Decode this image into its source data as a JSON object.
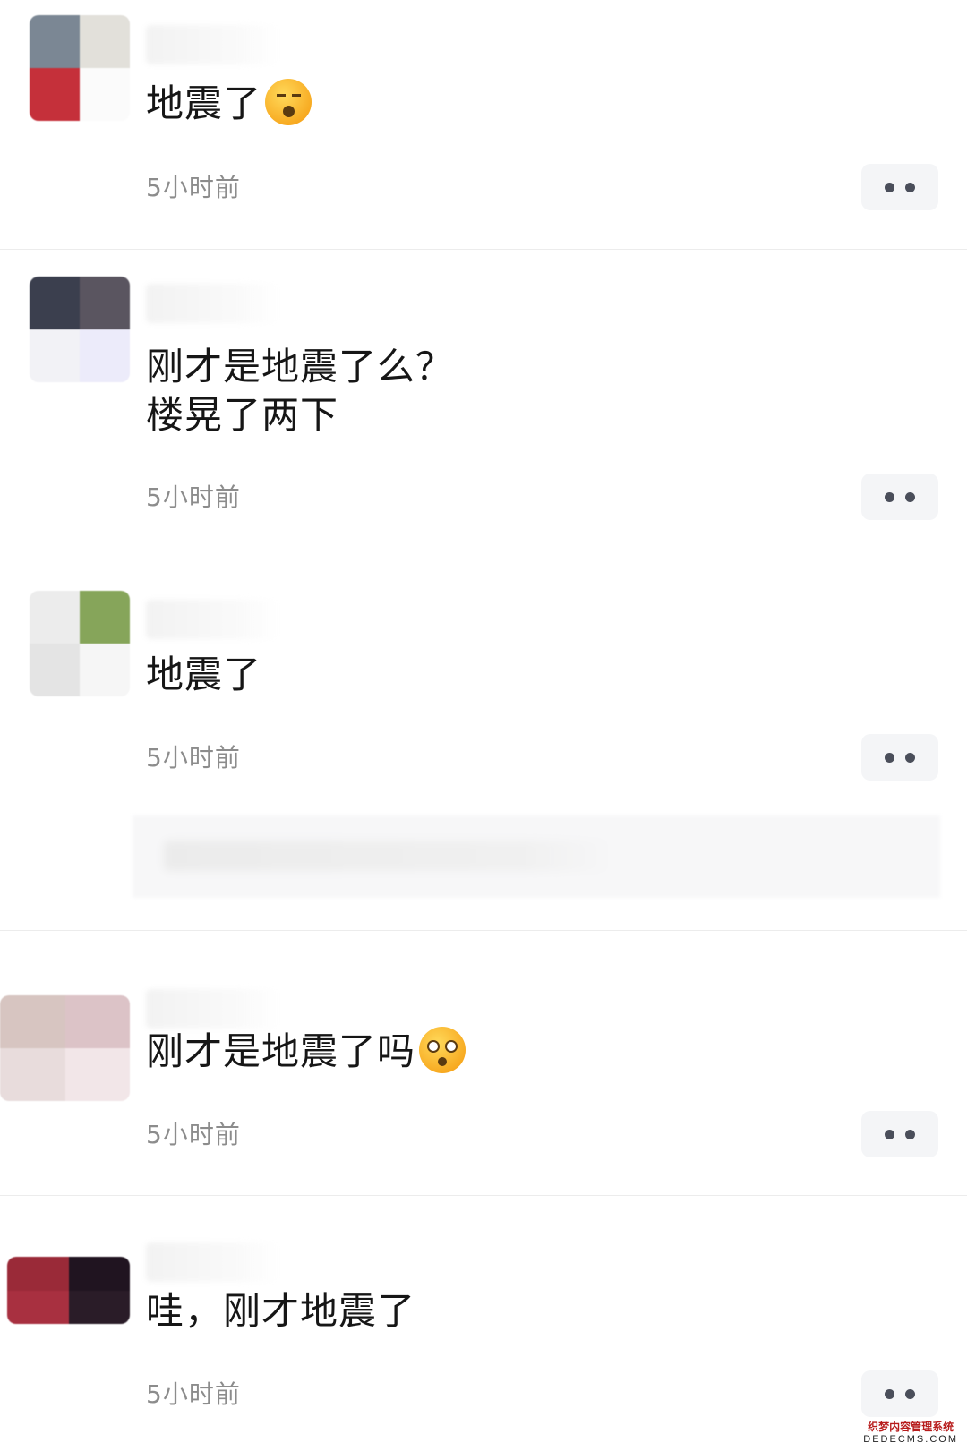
{
  "comments": [
    {
      "content": "地震了",
      "time": "5小时前",
      "emoji": "sleepy-face-icon"
    },
    {
      "content_lines": [
        "刚才是地震了么？",
        "楼晃了两下"
      ],
      "time": "5小时前"
    },
    {
      "content": "地震了",
      "time": "5小时前"
    },
    {
      "content": "刚才是地震了吗",
      "time": "5小时前",
      "emoji": "shocked-face-icon"
    },
    {
      "content": "哇，刚才地震了",
      "time": "5小时前"
    }
  ],
  "watermark": {
    "cn": "织梦内容管理系统",
    "en": "DEDECMS.COM"
  },
  "colors": {
    "text": "#161616",
    "time": "#8c8c8c",
    "more_dot": "#4a4e5a",
    "more_bg": "#f4f5f7",
    "divider": "#ececec"
  }
}
